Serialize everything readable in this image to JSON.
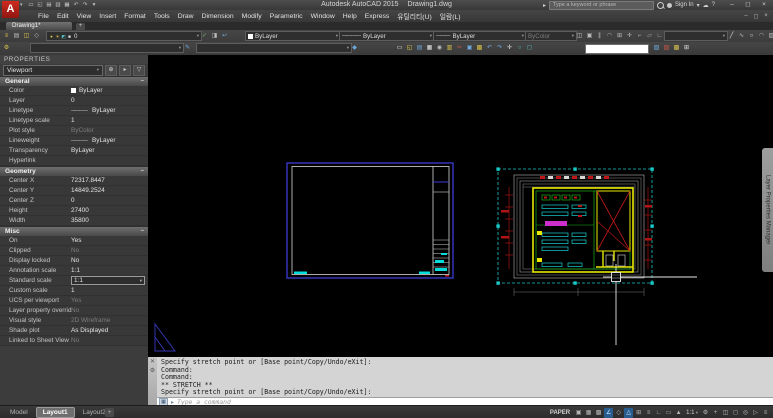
{
  "title_bar": {
    "logo_letter": "A",
    "app_title": "Autodesk AutoCAD 2015",
    "doc_title": "Drawing1.dwg",
    "search_placeholder": "Type a keyword or phrase",
    "sign_in_label": "Sign In",
    "quick_access": [
      {
        "name": "qnew-icon",
        "glyph": "▭"
      },
      {
        "name": "open-icon",
        "glyph": "◱"
      },
      {
        "name": "save-icon",
        "glyph": "▤"
      },
      {
        "name": "saveas-icon",
        "glyph": "▥"
      },
      {
        "name": "plot-icon",
        "glyph": "▦"
      },
      {
        "name": "undo-icon",
        "glyph": "↶"
      },
      {
        "name": "redo-icon",
        "glyph": "↷"
      },
      {
        "name": "qat-customize-icon",
        "glyph": "▾"
      }
    ],
    "cloud_icon_glyph": "☁",
    "help_icon_glyph": "?",
    "window_controls": [
      {
        "name": "minimize-button",
        "glyph": "–"
      },
      {
        "name": "restore-button",
        "glyph": "◻"
      },
      {
        "name": "close-button",
        "glyph": "×"
      }
    ]
  },
  "menu_bar": {
    "items": [
      "File",
      "Edit",
      "View",
      "Insert",
      "Format",
      "Tools",
      "Draw",
      "Dimension",
      "Modify",
      "Parametric",
      "Window",
      "Help",
      "Express",
      "유틸리티(U)",
      "일람(L)"
    ],
    "doc_controls": [
      {
        "name": "doc-minimize-button",
        "glyph": "–"
      },
      {
        "name": "doc-restore-button",
        "glyph": "◻"
      },
      {
        "name": "doc-close-button",
        "glyph": "×"
      }
    ]
  },
  "file_tabs": {
    "active_label": "Drawing1*",
    "new_tab_label": "+"
  },
  "toolbars": {
    "layer_value": "0",
    "color_value": "ByLayer",
    "linetype_value": "ByLayer",
    "lineweight_value": "ByLayer",
    "plotstyle_value": "ByColor",
    "r1_g1": [
      {
        "name": "layer-properties-manager-icon",
        "glyph": "≡",
        "cls": "c-yellow"
      },
      {
        "name": "layer-states-icon",
        "glyph": "▤"
      },
      {
        "name": "layer-isolate-icon",
        "glyph": "◫",
        "cls": "c-yellow"
      },
      {
        "name": "layer-unisolate-icon",
        "glyph": "◇"
      }
    ],
    "layer_dd_icons": [
      {
        "name": "layer-on-bulb-icon",
        "glyph": "●",
        "cls": "c-yellow"
      },
      {
        "name": "layer-freeze-sun-icon",
        "glyph": "☀",
        "cls": "c-yellow"
      },
      {
        "name": "layer-lock-icon",
        "glyph": "◩",
        "cls": "c-cyan"
      },
      {
        "name": "layer-color-swatch",
        "glyph": "■",
        "cls": "c-white"
      }
    ],
    "r1_g2": [
      {
        "name": "make-object-layer-current-icon",
        "glyph": "✓",
        "cls": "c-green"
      },
      {
        "name": "match-layer-icon",
        "glyph": "◨"
      },
      {
        "name": "layer-previous-icon",
        "glyph": "↩",
        "cls": "c-blue"
      }
    ],
    "r1_g3": [
      {
        "name": "erase-icon",
        "glyph": "◫"
      },
      {
        "name": "copy-icon",
        "glyph": "▣"
      },
      {
        "name": "mirror-icon",
        "glyph": "∥"
      },
      {
        "name": "offset-icon",
        "glyph": "◠"
      },
      {
        "name": "array-icon",
        "glyph": "⊞"
      },
      {
        "name": "move-icon",
        "glyph": "✛"
      },
      {
        "name": "rotate-icon",
        "glyph": "⌐"
      },
      {
        "name": "scale-icon",
        "glyph": "▱"
      },
      {
        "name": "trim-icon",
        "glyph": "∟"
      }
    ],
    "r1_g4": [
      {
        "name": "line-icon",
        "glyph": "╱",
        "cls": "c-white"
      },
      {
        "name": "polyline-icon",
        "glyph": "∿"
      },
      {
        "name": "circle-icon",
        "glyph": "○",
        "cls": "c-white"
      },
      {
        "name": "arc-icon",
        "glyph": "◠"
      },
      {
        "name": "hatch-icon",
        "glyph": "▨"
      }
    ],
    "r2_g1": [
      {
        "name": "workspace-icon",
        "glyph": "⚙",
        "cls": "c-yellow"
      }
    ],
    "r2_g2": [
      {
        "name": "text-style-icon",
        "glyph": "✎",
        "cls": "c-blue"
      }
    ],
    "r2_g3": [
      {
        "name": "dim-style-icon",
        "glyph": "◆",
        "cls": "c-blue"
      }
    ],
    "r2_std": [
      {
        "name": "new-icon",
        "glyph": "▭",
        "cls": "c-white"
      },
      {
        "name": "open-folder-icon",
        "glyph": "◱",
        "cls": "c-yellow"
      },
      {
        "name": "save-disk-icon",
        "glyph": "▤",
        "cls": "c-blue"
      },
      {
        "name": "plot-printer-icon",
        "glyph": "▦",
        "cls": "c-white"
      },
      {
        "name": "plot-preview-icon",
        "glyph": "◉"
      },
      {
        "name": "publish-icon",
        "glyph": "▥",
        "cls": "c-yellow"
      },
      {
        "name": "cut-icon",
        "glyph": "✂",
        "cls": "c-red"
      },
      {
        "name": "copy-clip-icon",
        "glyph": "▣",
        "cls": "c-blue"
      },
      {
        "name": "paste-icon",
        "glyph": "▩",
        "cls": "c-yellow"
      },
      {
        "name": "undo-arrow-icon",
        "glyph": "↶",
        "cls": "c-blue"
      },
      {
        "name": "redo-arrow-icon",
        "glyph": "↷",
        "cls": "c-blue"
      },
      {
        "name": "pan-icon",
        "glyph": "✛",
        "cls": "c-white"
      },
      {
        "name": "zoom-realtime-icon",
        "glyph": "○",
        "cls": "c-cyan"
      },
      {
        "name": "zoom-window-icon",
        "glyph": "◻",
        "cls": "c-cyan"
      }
    ],
    "r2_end": [
      {
        "name": "match-properties-icon",
        "glyph": "▨",
        "cls": "c-blue"
      },
      {
        "name": "annotate-icon",
        "glyph": "▧",
        "cls": "c-red"
      },
      {
        "name": "sheet-set-icon",
        "glyph": "▩",
        "cls": "c-yellow"
      },
      {
        "name": "calculator-icon",
        "glyph": "⊞",
        "cls": "c-white"
      }
    ]
  },
  "properties_panel": {
    "title": "PROPERTIES",
    "selector_value": "Viewport",
    "header_icons": [
      {
        "name": "pickadd-toggle-icon",
        "glyph": "⊕"
      },
      {
        "name": "select-objects-icon",
        "glyph": "▸"
      },
      {
        "name": "quick-select-icon",
        "glyph": "▽"
      }
    ],
    "sections": [
      {
        "name": "General",
        "rows": [
          {
            "label": "Color",
            "value": "ByLayer",
            "cls": "t-swatch"
          },
          {
            "label": "Layer",
            "value": "0"
          },
          {
            "label": "Linetype",
            "value": "ByLayer",
            "cls": "t-line"
          },
          {
            "label": "Linetype scale",
            "value": "1"
          },
          {
            "label": "Plot style",
            "value": "ByColor",
            "cls": "grayed"
          },
          {
            "label": "Lineweight",
            "value": "ByLayer",
            "cls": "t-line"
          },
          {
            "label": "Transparency",
            "value": "ByLayer"
          },
          {
            "label": "Hyperlink",
            "value": ""
          }
        ]
      },
      {
        "name": "Geometry",
        "rows": [
          {
            "label": "Center X",
            "value": "72317.8447"
          },
          {
            "label": "Center Y",
            "value": "14849.2524"
          },
          {
            "label": "Center Z",
            "value": "0"
          },
          {
            "label": "Height",
            "value": "27400"
          },
          {
            "label": "Width",
            "value": "35800"
          }
        ]
      },
      {
        "name": "Misc",
        "rows": [
          {
            "label": "On",
            "value": "Yes"
          },
          {
            "label": "Clipped",
            "value": "No",
            "cls": "grayed"
          },
          {
            "label": "Display locked",
            "value": "No"
          },
          {
            "label": "Annotation scale",
            "value": "1:1"
          },
          {
            "label": "Standard scale",
            "value": "1:1",
            "cls": "t-dd"
          },
          {
            "label": "Custom scale",
            "value": "1"
          },
          {
            "label": "UCS per viewport",
            "value": "Yes",
            "cls": "grayed"
          },
          {
            "label": "Layer property overrides",
            "value": "No",
            "cls": "grayed"
          },
          {
            "label": "Visual style",
            "value": "2D Wireframe",
            "cls": "grayed"
          },
          {
            "label": "Shade plot",
            "value": "As Displayed"
          },
          {
            "label": "Linked to Sheet View",
            "value": "No",
            "cls": "grayed"
          }
        ]
      }
    ]
  },
  "command_line": {
    "history": [
      "Specify stretch point or [Base point/Copy/Undo/eXit]:",
      "Command:",
      "Command:",
      "** STRETCH **",
      "Specify stretch point or [Base point/Copy/Undo/eXit]:"
    ],
    "input_placeholder": "Type a command",
    "prompt_glyph": "▸"
  },
  "status_bar": {
    "tabs": [
      {
        "label": "Model"
      },
      {
        "label": "Layout1",
        "cls": "active"
      },
      {
        "label": "Layout2"
      }
    ],
    "new_layout_label": "+",
    "paper_label": "PAPER",
    "scale_value": "1:1",
    "icons_a": [
      {
        "name": "quick-view-icon",
        "glyph": "▣"
      },
      {
        "name": "grid-display-icon",
        "glyph": "▦"
      },
      {
        "name": "snap-mode-icon",
        "glyph": "▩"
      },
      {
        "name": "polar-tracking-icon",
        "glyph": "∠",
        "cls": "act"
      },
      {
        "name": "isometric-drafting-icon",
        "glyph": "◇"
      },
      {
        "name": "object-snap-tracking-icon",
        "glyph": "△",
        "cls": "act"
      },
      {
        "name": "object-snap-icon",
        "glyph": "⊞"
      },
      {
        "name": "lineweight-display-icon",
        "glyph": "≡"
      },
      {
        "name": "dynamic-ucs-icon",
        "glyph": "∟"
      },
      {
        "name": "dynamic-input-icon",
        "glyph": "▭"
      },
      {
        "name": "annotation-visibility-icon",
        "glyph": "▲"
      }
    ],
    "icons_b": [
      {
        "name": "switch-workspace-icon",
        "glyph": "⚙"
      },
      {
        "name": "annotation-monitor-icon",
        "glyph": "+"
      },
      {
        "name": "quick-properties-icon",
        "glyph": "◫"
      },
      {
        "name": "lock-ui-icon",
        "glyph": "◻"
      },
      {
        "name": "isolate-objects-icon",
        "glyph": "◎"
      },
      {
        "name": "graphics-performance-icon",
        "glyph": "▷"
      },
      {
        "name": "customization-icon",
        "glyph": "≡"
      }
    ]
  },
  "right_tab": {
    "label": "Layer Properties Manager"
  }
}
